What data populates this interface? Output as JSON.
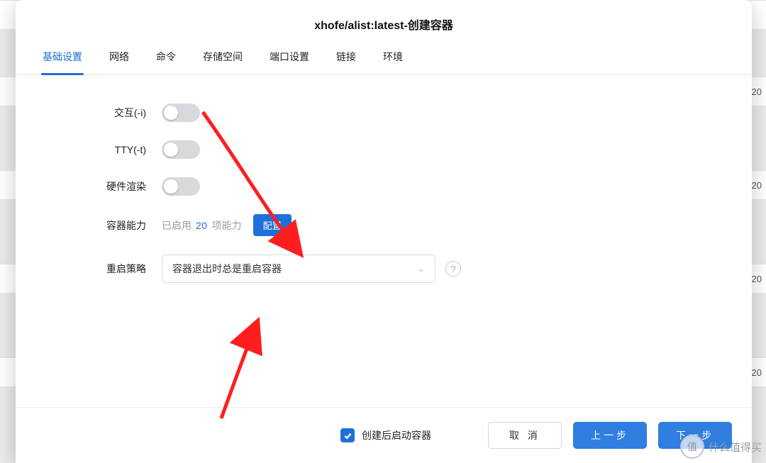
{
  "dialog": {
    "title": "xhofe/alist:latest-创建容器"
  },
  "tabs": [
    {
      "label": "基础设置",
      "active": true
    },
    {
      "label": "网络",
      "active": false
    },
    {
      "label": "命令",
      "active": false
    },
    {
      "label": "存储空间",
      "active": false
    },
    {
      "label": "端口设置",
      "active": false
    },
    {
      "label": "链接",
      "active": false
    },
    {
      "label": "环境",
      "active": false
    }
  ],
  "form": {
    "interactive": {
      "label": "交互(-i)",
      "on": false
    },
    "tty": {
      "label": "TTY(-t)",
      "on": false
    },
    "hw_render": {
      "label": "硬件渲染",
      "on": false
    },
    "capabilities": {
      "label": "容器能力",
      "enabled_prefix": "已启用",
      "count": "20",
      "enabled_suffix": "项能力",
      "configure": "配置"
    },
    "restart": {
      "label": "重启策略",
      "value": "容器退出时总是重启容器"
    }
  },
  "footer": {
    "start_after_create": "创建后启动容器",
    "cancel": "取 消",
    "prev": "上一步",
    "next": "下一步"
  },
  "bg_rows": [
    "20",
    "20",
    "20",
    "20"
  ],
  "watermark": {
    "char": "值",
    "text": "什么值得买"
  }
}
